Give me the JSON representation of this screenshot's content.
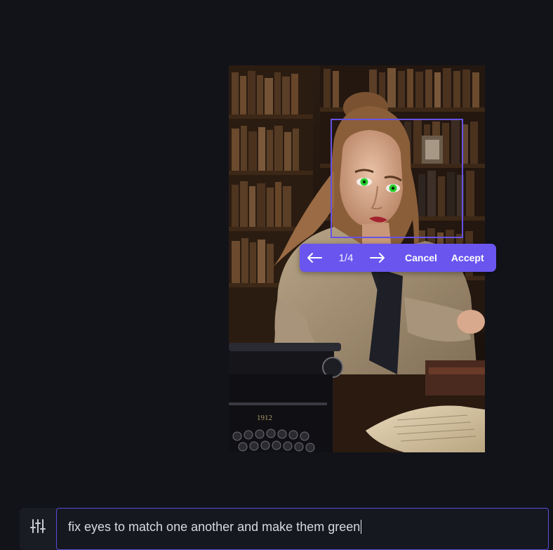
{
  "canvas": {
    "image_alt": "Woman in trench coat with green eyes seated at a typewriter in a library"
  },
  "iteration_toolbar": {
    "prev_icon": "arrow-left-icon",
    "counter": "1/4",
    "next_icon": "arrow-right-icon",
    "cancel_label": "Cancel",
    "accept_label": "Accept",
    "accent_color": "#6a55ef"
  },
  "prompt_bar": {
    "options_icon": "sliders-icon",
    "text": "fix eyes to match one another and make them green"
  },
  "colors": {
    "background": "#121319",
    "selection_border": "#6652e6",
    "prompt_border": "#5b4cd6"
  }
}
